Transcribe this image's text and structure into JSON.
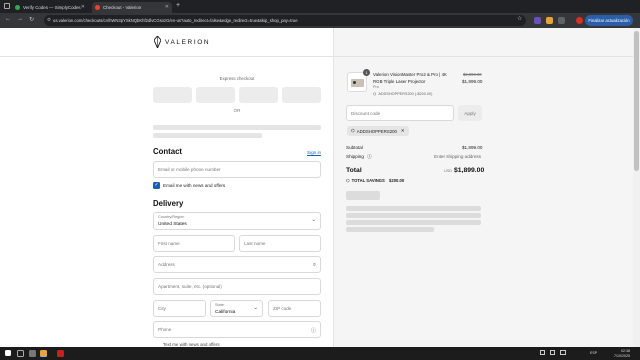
{
  "browser": {
    "tabs": [
      {
        "title": "Verify Codes — SimplyCodes",
        "fav_color": "#34a853"
      },
      {
        "title": "Checkout - Valerion",
        "fav_color": "#ea4335"
      }
    ],
    "new_tab": "+",
    "url": "us.valerion.com/checkouts/cn/hWN3pYSkNQbKhf2dlvCGsozG/en-us?auto_redirect=false&edge_redirect=true&skip_shop_pay=true",
    "update_button": "Finalizar actualización"
  },
  "header": {
    "logo_text": "VALERION"
  },
  "checkout": {
    "express_label": "Express checkout",
    "or_label": "OR",
    "contact": {
      "title": "Contact",
      "sign_in": "Sign in",
      "email_placeholder": "Email or mobile phone number",
      "newsletter_label": "Email me with news and offers",
      "newsletter_checked": true
    },
    "delivery": {
      "title": "Delivery",
      "country_label": "Country/Region",
      "country_value": "United States",
      "first_name": "First name",
      "last_name": "Last name",
      "address": "Address",
      "apartment": "Apartment, suite, etc. (optional)",
      "city": "City",
      "state_label": "State",
      "state_value": "California",
      "zip": "ZIP code",
      "phone": "Phone",
      "text_me": "Text me with news and offers"
    }
  },
  "summary": {
    "quantity": "1",
    "product_name_line1": "Valerion VisionMaster Pro2 & Pro | 4K",
    "product_name_line2": "RGB Triple Laser Projector",
    "variant": "Pro",
    "discount_line": "ADDSHOPPERS200 (-$200.00)",
    "original_price": "$2,099.00",
    "price": "$1,899.00",
    "discount_placeholder": "Discount code",
    "apply_label": "Apply",
    "applied_code": "ADDSHOPPERS200",
    "subtotal_label": "Subtotal",
    "subtotal_value": "$1,899.00",
    "shipping_label": "Shipping",
    "shipping_value": "Enter shipping address",
    "total_label": "Total",
    "currency": "USD",
    "total_value": "$1,899.00",
    "savings_label": "TOTAL SAVINGS",
    "savings_value": "$200.00"
  },
  "taskbar": {
    "lang": "ESP",
    "time": "02:38",
    "date": "7/10/2025"
  }
}
